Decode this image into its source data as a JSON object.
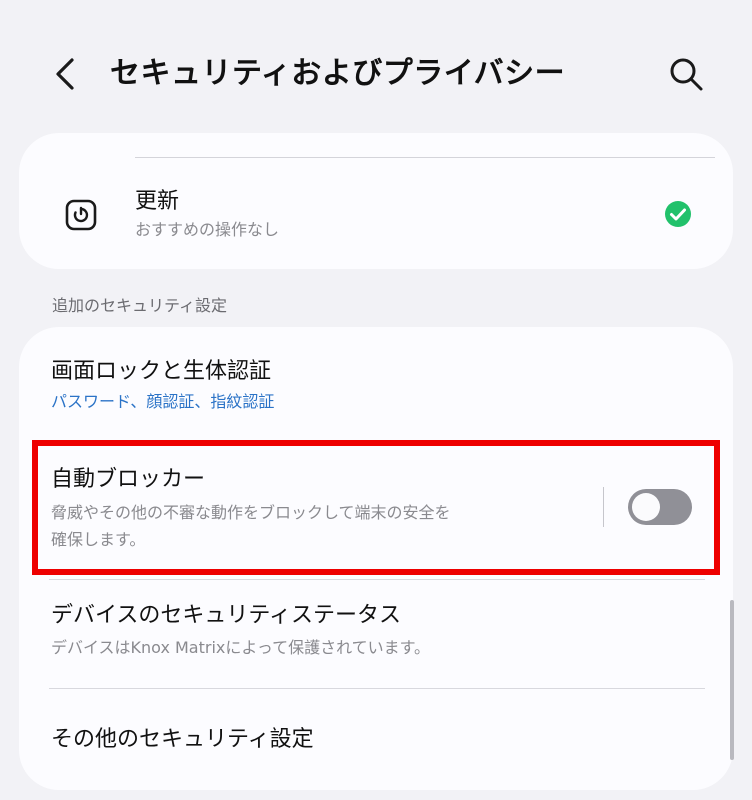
{
  "header": {
    "title": "セキュリティおよびプライバシー",
    "back_icon": "chevron-left-icon",
    "search_icon": "search-icon"
  },
  "updates_card": {
    "title": "更新",
    "subtitle": "おすすめの操作なし",
    "icon": "update-icon",
    "status_icon": "check-circle-icon",
    "status_color": "#21c16b"
  },
  "section": {
    "title": "追加のセキュリティ設定"
  },
  "items": [
    {
      "title": "画面ロックと生体認証",
      "subtitle": "パスワード、顔認証、指紋認証"
    },
    {
      "title": "自動ブロッカー",
      "subtitle_line1": "脅威やその他の不審な動作をブロックして端末の安全を",
      "subtitle_line2": "確保します。",
      "toggle_state": "off"
    },
    {
      "title": "デバイスのセキュリティステータス",
      "subtitle": "デバイスはKnox Matrixによって保護されています。"
    },
    {
      "title": "その他のセキュリティ設定"
    }
  ],
  "colors": {
    "accent_blue": "#2b73c7",
    "highlight_red": "#ee0000",
    "toggle_off": "#909097",
    "background": "#f2f2f6"
  }
}
